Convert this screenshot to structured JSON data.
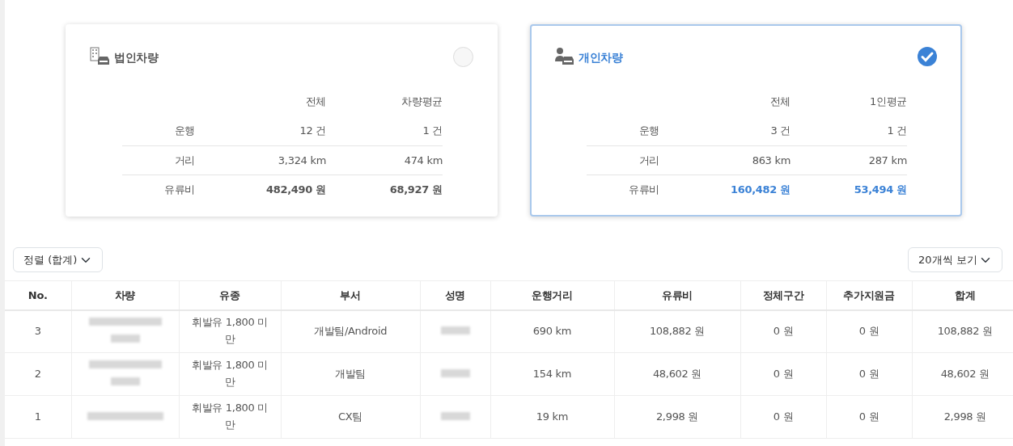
{
  "cards": [
    {
      "title": "법인차량",
      "kind": "building",
      "selected": false,
      "columns": [
        "전체",
        "차량평균"
      ],
      "rows": [
        {
          "label": "운행",
          "values": [
            "12 건",
            "1 건"
          ],
          "bold": false
        },
        {
          "label": "거리",
          "values": [
            "3,324 km",
            "474 km"
          ],
          "bold": false
        },
        {
          "label": "유류비",
          "values": [
            "482,490 원",
            "68,927 원"
          ],
          "bold": true
        }
      ]
    },
    {
      "title": "개인차량",
      "kind": "person",
      "selected": true,
      "columns": [
        "전체",
        "1인평균"
      ],
      "rows": [
        {
          "label": "운행",
          "values": [
            "3 건",
            "1 건"
          ],
          "bold": false
        },
        {
          "label": "거리",
          "values": [
            "863 km",
            "287 km"
          ],
          "bold": false
        },
        {
          "label": "유류비",
          "values": [
            "160,482 원",
            "53,494 원"
          ],
          "bold": true
        }
      ]
    }
  ],
  "sort_select": {
    "value": "정렬 (합계)"
  },
  "page_size_select": {
    "value": "20개씩 보기"
  },
  "table": {
    "columns": [
      "No.",
      "차량",
      "유종",
      "부서",
      "성명",
      "운행거리",
      "유류비",
      "정체구간",
      "추가지원금",
      "합계"
    ],
    "rows": [
      {
        "cells": [
          {
            "kind": "text",
            "text": "3"
          },
          {
            "kind": "blurred_two_line"
          },
          {
            "kind": "text",
            "text": "휘발유 1,800 미만"
          },
          {
            "kind": "text",
            "text": "개발팀/Android"
          },
          {
            "kind": "blurred"
          },
          {
            "kind": "text",
            "text": "690 km"
          },
          {
            "kind": "text",
            "text": "108,882 원"
          },
          {
            "kind": "text",
            "text": "0 원"
          },
          {
            "kind": "text",
            "text": "0 원"
          },
          {
            "kind": "text",
            "text": "108,882 원"
          }
        ]
      },
      {
        "cells": [
          {
            "kind": "text",
            "text": "2"
          },
          {
            "kind": "blurred_two_line"
          },
          {
            "kind": "text",
            "text": "휘발유 1,800 미만"
          },
          {
            "kind": "text",
            "text": "개발팀"
          },
          {
            "kind": "blurred"
          },
          {
            "kind": "text",
            "text": "154 km"
          },
          {
            "kind": "text",
            "text": "48,602 원"
          },
          {
            "kind": "text",
            "text": "0 원"
          },
          {
            "kind": "text",
            "text": "0 원"
          },
          {
            "kind": "text",
            "text": "48,602 원"
          }
        ]
      },
      {
        "cells": [
          {
            "kind": "text",
            "text": "1"
          },
          {
            "kind": "blurred"
          },
          {
            "kind": "text",
            "text": "휘발유 1,800 미만"
          },
          {
            "kind": "text",
            "text": "CX팀"
          },
          {
            "kind": "blurred"
          },
          {
            "kind": "text",
            "text": "19 km"
          },
          {
            "kind": "text",
            "text": "2,998 원"
          },
          {
            "kind": "text",
            "text": "0 원"
          },
          {
            "kind": "text",
            "text": "0 원"
          },
          {
            "kind": "text",
            "text": "2,998 원"
          }
        ]
      }
    ]
  }
}
